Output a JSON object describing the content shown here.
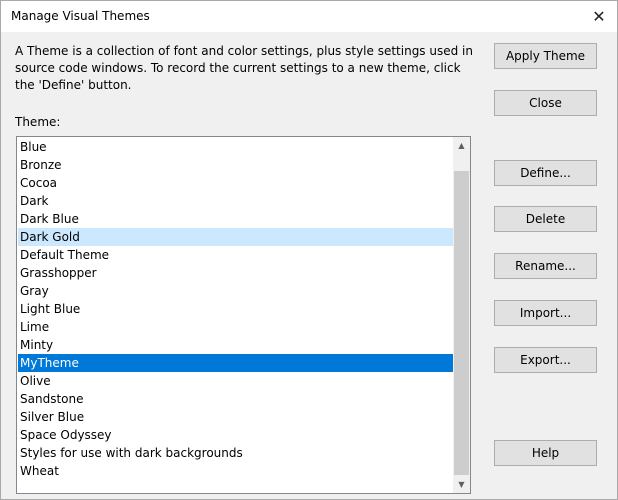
{
  "window": {
    "title": "Manage Visual Themes",
    "close_glyph": "✕"
  },
  "description": "A Theme is a collection of font and color settings, plus style settings used in source code windows. To record the current settings to a new theme, click the 'Define' button.",
  "theme_label": "Theme:",
  "themes": [
    "Blue",
    "Bronze",
    "Cocoa",
    "Dark",
    "Dark Blue",
    "Dark Gold",
    "Default Theme",
    "Grasshopper",
    "Gray",
    "Light Blue",
    "Lime",
    "Minty",
    "MyTheme",
    "Olive",
    "Sandstone",
    "Silver Blue",
    "Space Odyssey",
    "Styles for use with dark backgrounds",
    "Wheat"
  ],
  "hovered_theme": "Dark Gold",
  "selected_theme": "MyTheme",
  "buttons": {
    "apply": "Apply Theme",
    "close": "Close",
    "define": "Define...",
    "delete": "Delete",
    "rename": "Rename...",
    "import": "Import...",
    "export": "Export...",
    "help": "Help"
  },
  "scrollbar": {
    "up_glyph": "▲",
    "down_glyph": "▼"
  },
  "colors": {
    "selection": "#0078d7",
    "hover": "#cce8ff"
  }
}
